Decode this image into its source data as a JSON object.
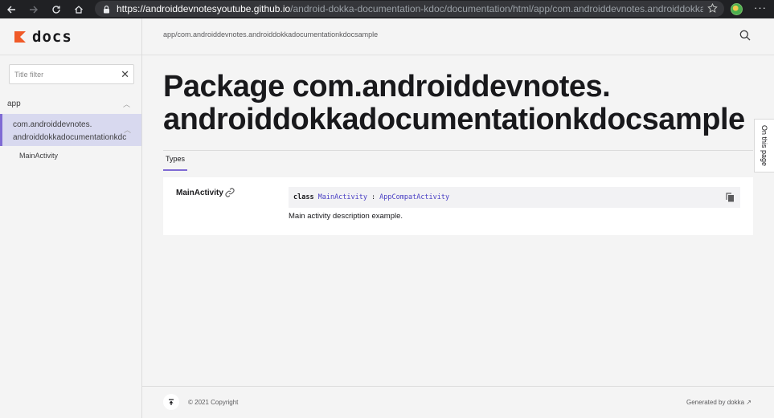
{
  "browser": {
    "url_host": "https://androiddevnotesyoutube.github.io",
    "url_path": "/android-dokka-documentation-kdoc/documentation/html/app/com.androiddevnotes.androiddokkadocumentationkdo..."
  },
  "sidebar": {
    "logo_text": "docs",
    "filter_placeholder": "Title filter",
    "nav": [
      {
        "label": "app"
      },
      {
        "label_line1": "com.androiddevnotes.",
        "label_line2": "androiddokkadocumentationkdc"
      },
      {
        "label": "MainActivity"
      }
    ]
  },
  "header": {
    "breadcrumb": "app/com.androiddevnotes.androiddokkadocumentationkdocsample"
  },
  "main": {
    "title_line1": "Package com.androiddevnotes.",
    "title_line2": "androiddokkadocumentationkdocsample",
    "on_this_page": "On this page",
    "tab_types": "Types",
    "entry": {
      "name": "MainActivity",
      "sig_keyword": "class",
      "sig_name": "MainActivity",
      "sig_sep": ":",
      "sig_super": "AppCompatActivity",
      "description": "Main activity description example."
    }
  },
  "footer": {
    "copyright": "© 2021 Copyright",
    "generated": "Generated by dokka ↗"
  },
  "colors": {
    "accent": "#7f6bd4",
    "link": "#4a40c4",
    "selected_bg": "#d8d9ef"
  }
}
